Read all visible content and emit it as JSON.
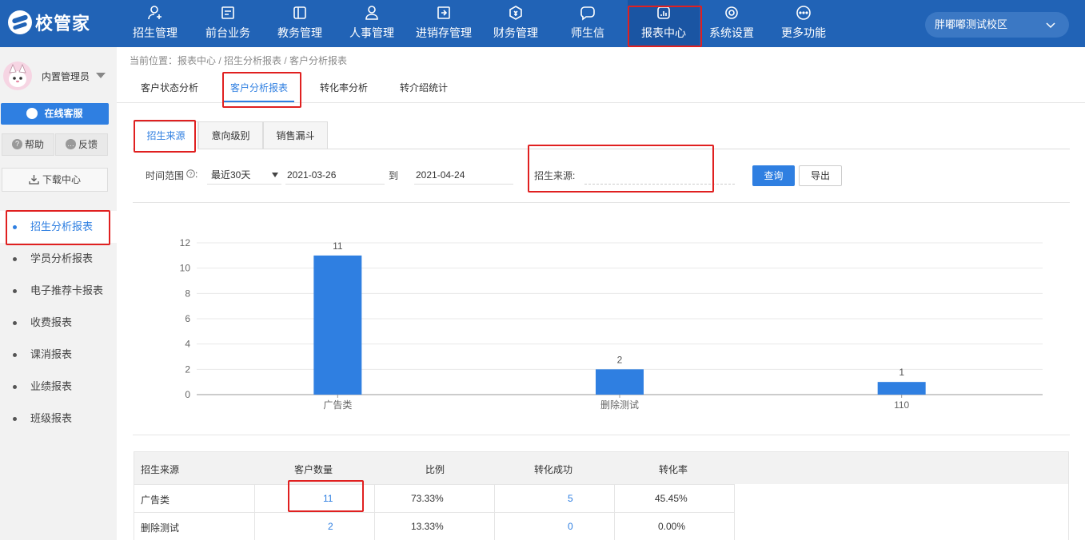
{
  "brand": {
    "name": "校管家"
  },
  "nav": [
    {
      "label": "招生管理",
      "icon": "user-add-icon"
    },
    {
      "label": "前台业务",
      "icon": "reception-icon"
    },
    {
      "label": "教务管理",
      "icon": "book-icon"
    },
    {
      "label": "人事管理",
      "icon": "person-icon"
    },
    {
      "label": "进销存管理",
      "icon": "inventory-icon"
    },
    {
      "label": "财务管理",
      "icon": "finance-icon"
    },
    {
      "label": "师生信",
      "icon": "message-icon"
    },
    {
      "label": "报表中心",
      "icon": "report-icon"
    },
    {
      "label": "系统设置",
      "icon": "settings-icon"
    },
    {
      "label": "更多功能",
      "icon": "more-icon"
    }
  ],
  "campus": {
    "label": "胖嘟嘟测试校区"
  },
  "sidebar": {
    "user_name": "内置管理员",
    "service_label": "在线客服",
    "help_label": "帮助",
    "feedback_label": "反馈",
    "download_label": "下载中心",
    "items": [
      {
        "label": "招生分析报表"
      },
      {
        "label": "学员分析报表"
      },
      {
        "label": "电子推荐卡报表"
      },
      {
        "label": "收费报表"
      },
      {
        "label": "课消报表"
      },
      {
        "label": "业绩报表"
      },
      {
        "label": "班级报表"
      }
    ]
  },
  "breadcrumb": "当前位置：报表中心 / 招生分析报表 / 客户分析报表",
  "tabs": [
    "客户状态分析",
    "客户分析报表",
    "转化率分析",
    "转介绍统计"
  ],
  "subtabs": [
    "招生来源",
    "意向级别",
    "销售漏斗"
  ],
  "filters": {
    "time_range_label": "时间范围",
    "range_value": "最近30天",
    "date_from": "2021-03-26",
    "to_label": "到",
    "date_to": "2021-04-24",
    "source_label": "招生来源:",
    "query_label": "查询",
    "export_label": "导出"
  },
  "chart_data": {
    "type": "bar",
    "categories": [
      "广告类",
      "删除测试",
      "110"
    ],
    "values": [
      11,
      2,
      1
    ],
    "ylim": [
      0,
      12
    ],
    "yticks": [
      0,
      2,
      4,
      6,
      8,
      10,
      12
    ],
    "grid": true,
    "bar_color": "#2f7fe1"
  },
  "table": {
    "headers": [
      "招生来源",
      "客户数量",
      "比例",
      "转化成功",
      "转化率"
    ],
    "rows": [
      [
        "广告类",
        "11",
        "73.33%",
        "5",
        "45.45%"
      ],
      [
        "删除测试",
        "2",
        "13.33%",
        "0",
        "0.00%"
      ]
    ]
  },
  "colors": {
    "nav_bg": "#2163b6",
    "accent": "#2f7fe1",
    "highlight": "#e02020"
  }
}
